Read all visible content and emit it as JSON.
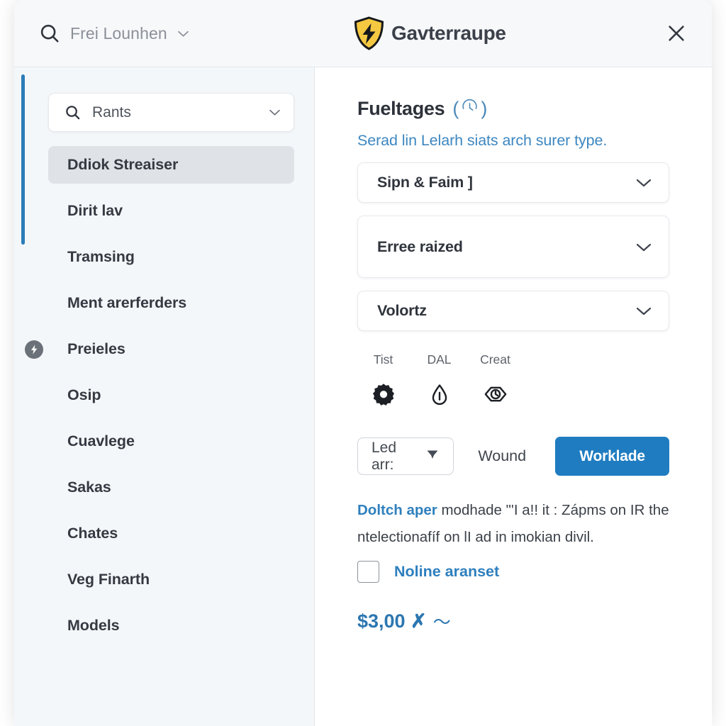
{
  "header": {
    "search_label": "Frei Lounhen",
    "search_icon": "search-icon",
    "search_chevron_icon": "chevron-down-icon",
    "logo_icon": "shield-lightning-logo",
    "title": "Gavterraupe",
    "close_icon": "close-icon"
  },
  "sidebar": {
    "search": {
      "value": "Rants",
      "icon": "search-icon",
      "chevron_icon": "chevron-down-icon"
    },
    "items": [
      {
        "label": "Ddiok Streaiser",
        "active": true,
        "badge": false
      },
      {
        "label": "Dirit lav",
        "active": false,
        "badge": false
      },
      {
        "label": "Tramsing",
        "active": false,
        "badge": false
      },
      {
        "label": "Ment arerferders",
        "active": false,
        "badge": false
      },
      {
        "label": "Preieles",
        "active": false,
        "badge": true,
        "badge_icon": "lightning-badge-icon"
      },
      {
        "label": "Osip",
        "active": false,
        "badge": false
      },
      {
        "label": "Cuavlege",
        "active": false,
        "badge": false
      },
      {
        "label": "Sakas",
        "active": false,
        "badge": false
      },
      {
        "label": "Chates",
        "active": false,
        "badge": false
      },
      {
        "label": "Veg Finarth",
        "active": false,
        "badge": false
      },
      {
        "label": "Models",
        "active": false,
        "badge": false
      }
    ]
  },
  "main": {
    "heading": "Fueltages",
    "heading_badge_open": "(",
    "heading_badge_icon": "gauge-circle-icon",
    "heading_badge_close": ")",
    "subtitle": "Serad lin Lelarh siats arch surer type.",
    "selects": [
      {
        "value": "Sipn & Faim ]",
        "chevron_icon": "chevron-down-icon",
        "tall": false
      },
      {
        "value": "Erree raized",
        "chevron_icon": "chevron-down-icon",
        "tall": true
      },
      {
        "value": "Volortz",
        "chevron_icon": "chevron-down-icon",
        "tall": false
      }
    ],
    "icon_row": [
      {
        "label": "Tist",
        "icon": "gear-icon"
      },
      {
        "label": "DAL",
        "icon": "droplet-icon"
      },
      {
        "label": "Creat",
        "icon": "hexagon-clock-icon"
      }
    ],
    "dropdown_button": {
      "label": "Led arr:",
      "caret_icon": "caret-down-icon"
    },
    "secondary_action": "Wound",
    "primary_button": "Worklade",
    "note": {
      "lead": "Doltch aper",
      "rest": " modhade \"'I  a!! it : Zápms on IR the ntelectionafíf on lI ad in imokian divil."
    },
    "checkbox": {
      "label": "Noline aranset",
      "checked": false
    },
    "price": "$3,00 ✗",
    "price_suffix": "～"
  },
  "colors": {
    "accent_blue": "#2b7cb8",
    "primary_button": "#1f7cc0",
    "link_blue": "#3d87c0",
    "logo_yellow": "#F5C842",
    "badge_gray": "#6b7178",
    "sidebar_bg": "#f4f7fa",
    "header_bg": "#f7f8fa"
  }
}
